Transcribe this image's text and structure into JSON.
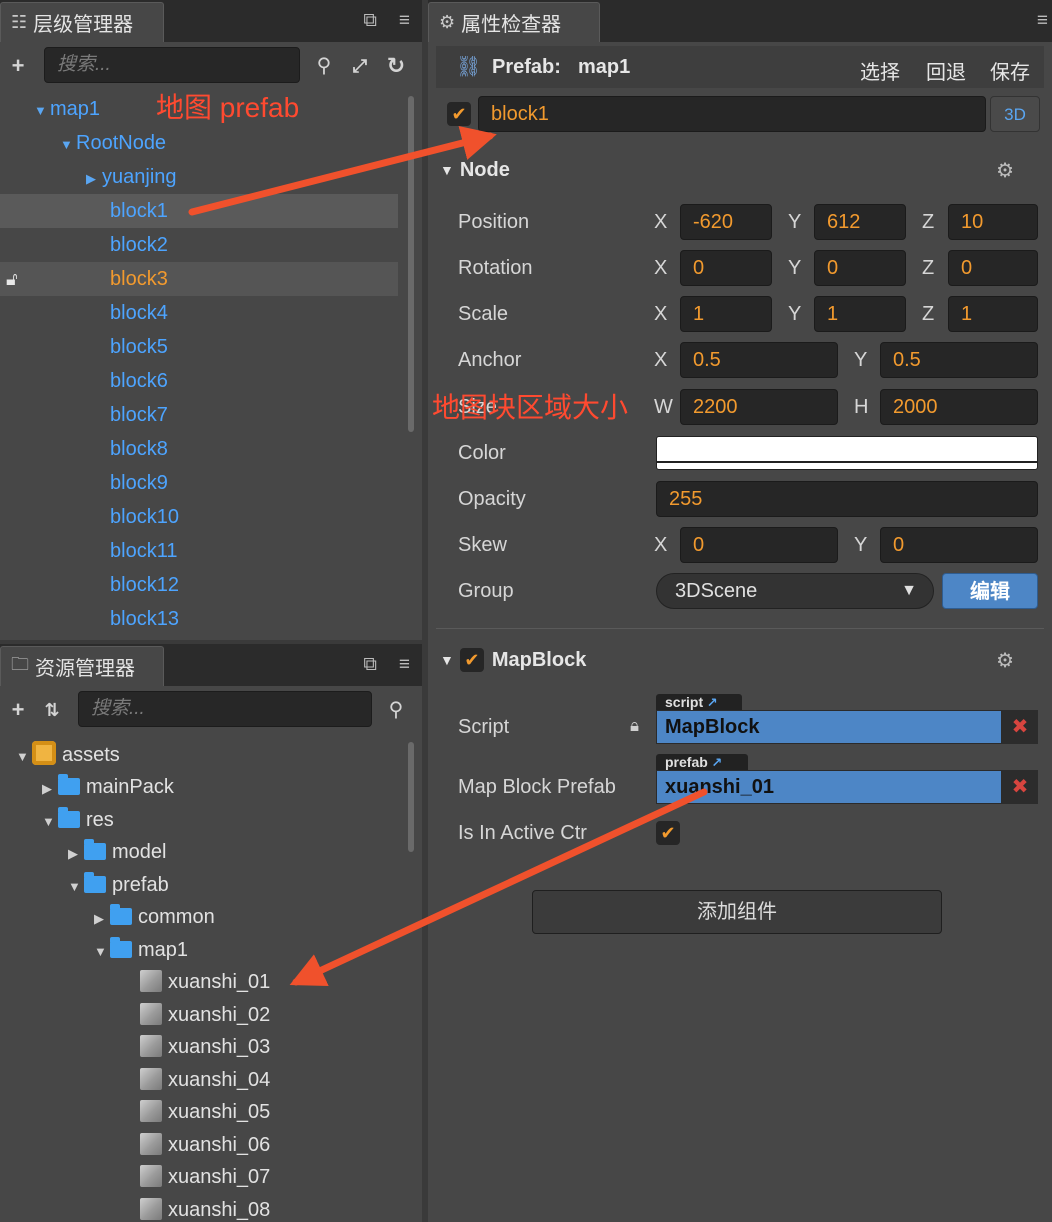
{
  "hierarchy": {
    "tab_title": "层级管理器",
    "search_placeholder": "搜索...",
    "items": [
      {
        "label": "map1"
      },
      {
        "label": "RootNode"
      },
      {
        "label": "yuanjing"
      },
      {
        "label": "block1"
      },
      {
        "label": "block2"
      },
      {
        "label": "block3"
      },
      {
        "label": "block4"
      },
      {
        "label": "block5"
      },
      {
        "label": "block6"
      },
      {
        "label": "block7"
      },
      {
        "label": "block8"
      },
      {
        "label": "block9"
      },
      {
        "label": "block10"
      },
      {
        "label": "block11"
      },
      {
        "label": "block12"
      },
      {
        "label": "block13"
      }
    ]
  },
  "assets": {
    "tab_title": "资源管理器",
    "search_placeholder": "搜索...",
    "items": [
      {
        "label": "assets"
      },
      {
        "label": "mainPack"
      },
      {
        "label": "res"
      },
      {
        "label": "model"
      },
      {
        "label": "prefab"
      },
      {
        "label": "common"
      },
      {
        "label": "map1"
      },
      {
        "label": "xuanshi_01"
      },
      {
        "label": "xuanshi_02"
      },
      {
        "label": "xuanshi_03"
      },
      {
        "label": "xuanshi_04"
      },
      {
        "label": "xuanshi_05"
      },
      {
        "label": "xuanshi_06"
      },
      {
        "label": "xuanshi_07"
      },
      {
        "label": "xuanshi_08"
      }
    ]
  },
  "inspector": {
    "tab_title": "属性检查器",
    "prefab_label": "Prefab:",
    "prefab_name": "map1",
    "select_btn": "选择",
    "revert_btn": "回退",
    "save_btn": "保存",
    "node_name": "block1",
    "btn_3d": "3D",
    "node_section": "Node",
    "position": {
      "label": "Position",
      "x": "-620",
      "y": "612",
      "z": "10"
    },
    "rotation": {
      "label": "Rotation",
      "x": "0",
      "y": "0",
      "z": "0"
    },
    "scale": {
      "label": "Scale",
      "x": "1",
      "y": "1",
      "z": "1"
    },
    "anchor": {
      "label": "Anchor",
      "x": "0.5",
      "y": "0.5"
    },
    "size": {
      "label": "Size",
      "w": "2200",
      "h": "2000"
    },
    "color": {
      "label": "Color",
      "value": "#ffffff"
    },
    "opacity": {
      "label": "Opacity",
      "value": "255"
    },
    "skew": {
      "label": "Skew",
      "x": "0",
      "y": "0"
    },
    "group": {
      "label": "Group",
      "value": "3DScene",
      "edit": "编辑"
    },
    "mapblock_section": "MapBlock",
    "script": {
      "label": "Script",
      "tag": "script",
      "value": "MapBlock"
    },
    "map_block_prefab": {
      "label": "Map Block Prefab",
      "tag": "prefab",
      "value": "xuanshi_01"
    },
    "is_in_active_ctr": {
      "label": "Is In Active Ctr"
    },
    "add_component": "添加组件"
  },
  "axes": {
    "x": "X",
    "y": "Y",
    "z": "Z",
    "w": "W",
    "h": "H"
  },
  "annotations": {
    "prefab_note": "地图 prefab",
    "size_note": "地图块区域大小"
  },
  "colors": {
    "accent_orange": "#f29a2e",
    "tree_blue": "#4da4ff",
    "annotation_red": "#ff4a30"
  }
}
